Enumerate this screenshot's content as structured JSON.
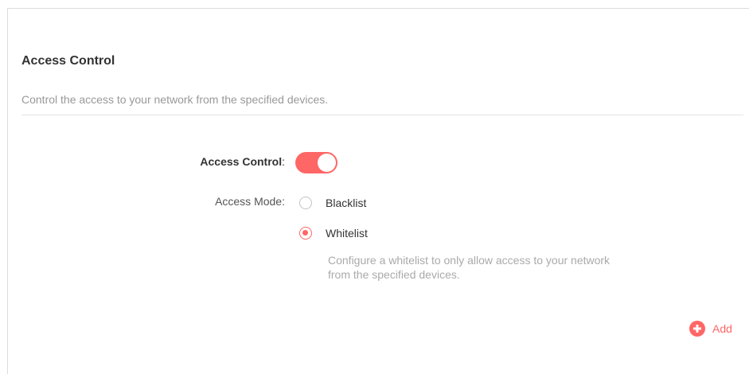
{
  "section": {
    "title": "Access Control",
    "description": "Control the access to your network from the specified devices."
  },
  "access_control": {
    "label": "Access Control",
    "colon": ":",
    "enabled": true
  },
  "access_mode": {
    "label": "Access Mode:",
    "options": [
      {
        "label": "Blacklist",
        "checked": false
      },
      {
        "label": "Whitelist",
        "checked": true
      }
    ],
    "help_line1": "Configure a whitelist to only allow access to your network",
    "help_line2": "from the specified devices."
  },
  "add_button": {
    "label": "Add"
  },
  "colors": {
    "accent": "#ff6666",
    "muted_text": "#999999"
  }
}
